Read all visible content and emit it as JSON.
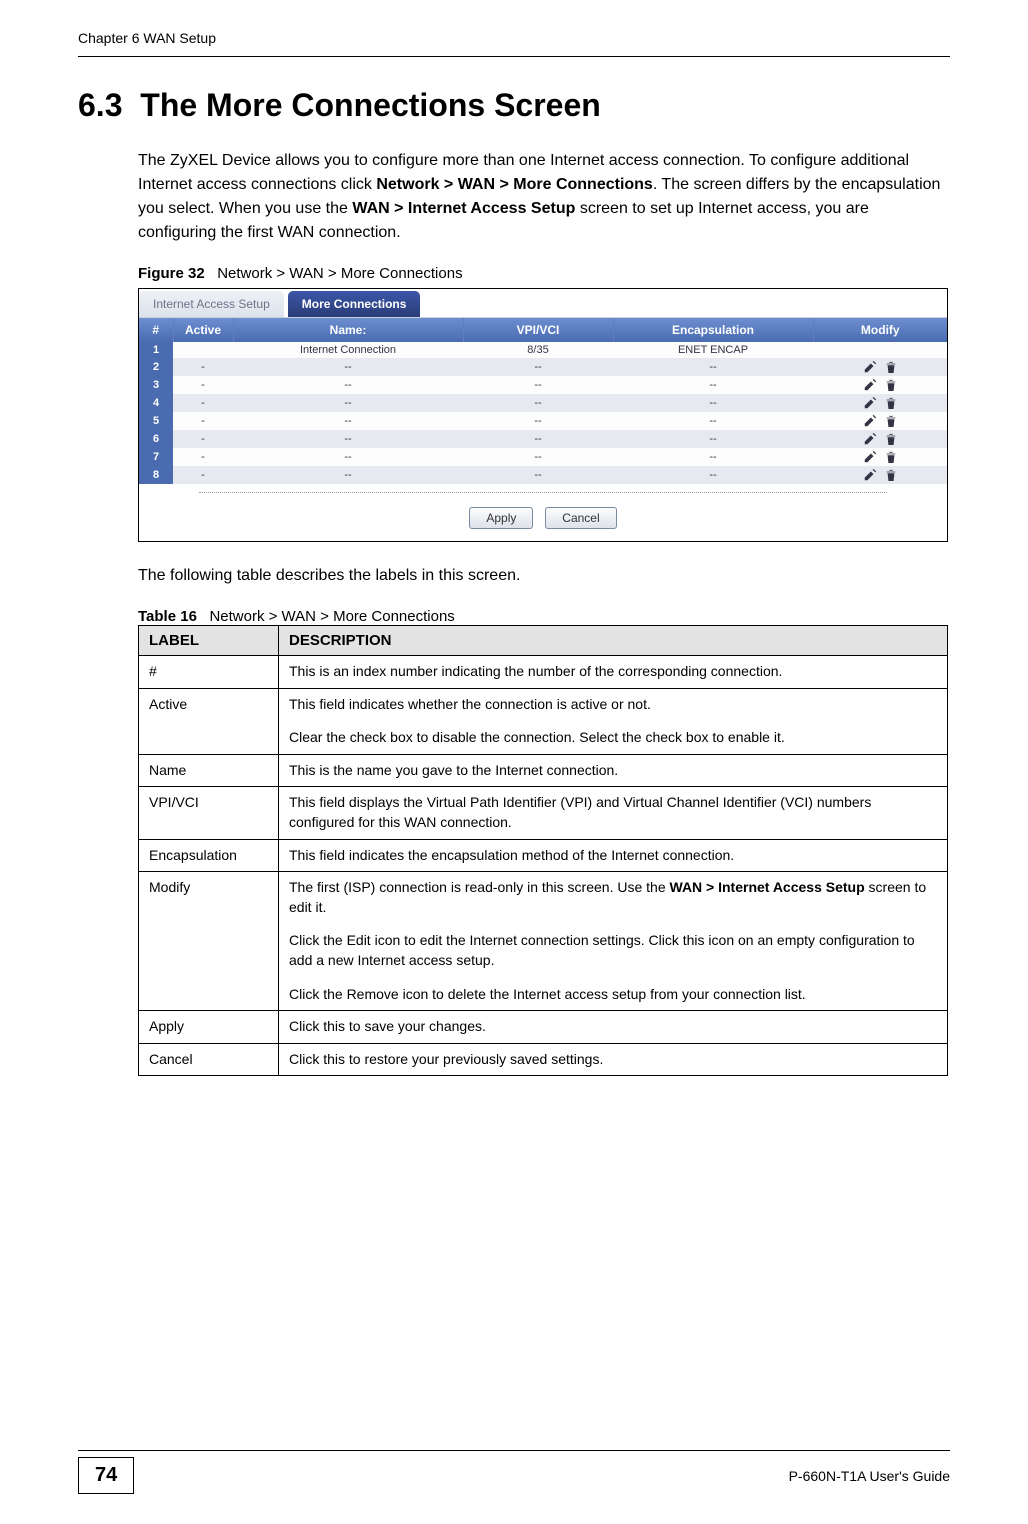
{
  "chapter": "Chapter 6 WAN Setup",
  "section_number": "6.3",
  "section_title": "The More Connections Screen",
  "intro_parts": {
    "p1": "The ZyXEL Device allows you to configure more than one Internet access connection. To configure additional Internet access connections click ",
    "b1": "Network > WAN > More Connections",
    "p2": ". The screen differs by the encapsulation you select. When you use the ",
    "b2": "WAN > Internet Access Setup",
    "p3": " screen to set up Internet access, you are configuring the first WAN connection."
  },
  "figure": {
    "label": "Figure 32",
    "caption": "Network > WAN > More Connections"
  },
  "tabs": {
    "inactive": "Internet Access Setup",
    "active": "More Connections"
  },
  "conn_headers": {
    "num": "#",
    "active": "Active",
    "name": "Name:",
    "vpi": "VPI/VCI",
    "encap": "Encapsulation",
    "modify": "Modify"
  },
  "conn_rows": [
    {
      "n": "1",
      "active": "",
      "name": "Internet Connection",
      "vpi": "8/35",
      "encap": "ENET ENCAP",
      "edit": false
    },
    {
      "n": "2",
      "active": "-",
      "name": "--",
      "vpi": "--",
      "encap": "--",
      "edit": true
    },
    {
      "n": "3",
      "active": "-",
      "name": "--",
      "vpi": "--",
      "encap": "--",
      "edit": true
    },
    {
      "n": "4",
      "active": "-",
      "name": "--",
      "vpi": "--",
      "encap": "--",
      "edit": true
    },
    {
      "n": "5",
      "active": "-",
      "name": "--",
      "vpi": "--",
      "encap": "--",
      "edit": true
    },
    {
      "n": "6",
      "active": "-",
      "name": "--",
      "vpi": "--",
      "encap": "--",
      "edit": true
    },
    {
      "n": "7",
      "active": "-",
      "name": "--",
      "vpi": "--",
      "encap": "--",
      "edit": true
    },
    {
      "n": "8",
      "active": "-",
      "name": "--",
      "vpi": "--",
      "encap": "--",
      "edit": true
    }
  ],
  "buttons": {
    "apply": "Apply",
    "cancel": "Cancel"
  },
  "after_figure": "The following table describes the labels in this screen.",
  "table": {
    "label": "Table 16",
    "caption": "Network > WAN > More Connections",
    "head_label": "LABEL",
    "head_desc": "DESCRIPTION",
    "rows": {
      "hash": {
        "label": "#",
        "desc": "This is an index number indicating the number of the corresponding connection."
      },
      "active": {
        "label": "Active",
        "d1": "This field indicates whether the connection is active or not.",
        "d2": "Clear the check box to disable the connection. Select the check box to enable it."
      },
      "name": {
        "label": "Name",
        "desc": "This is the name you gave to the Internet connection."
      },
      "vpi": {
        "label": "VPI/VCI",
        "desc": "This field displays the Virtual Path Identifier (VPI) and Virtual Channel Identifier (VCI) numbers configured for this WAN connection."
      },
      "encap": {
        "label": "Encapsulation",
        "desc": "This field indicates the encapsulation method of the Internet connection."
      },
      "modify": {
        "label": "Modify",
        "d1a": "The first (ISP) connection is read-only in this screen. Use the ",
        "d1b": "WAN > Internet Access Setup",
        "d1c": " screen to edit it.",
        "d2": "Click the Edit icon to edit the Internet connection settings. Click this icon on an empty configuration to add a new Internet access setup.",
        "d3": "Click the Remove icon to delete the Internet access setup from your connection list."
      },
      "apply": {
        "label": "Apply",
        "desc": "Click this to save your changes."
      },
      "cancel": {
        "label": "Cancel",
        "desc": "Click this to restore your previously saved settings."
      }
    }
  },
  "footer": {
    "page": "74",
    "guide": "P-660N-T1A User's Guide"
  }
}
